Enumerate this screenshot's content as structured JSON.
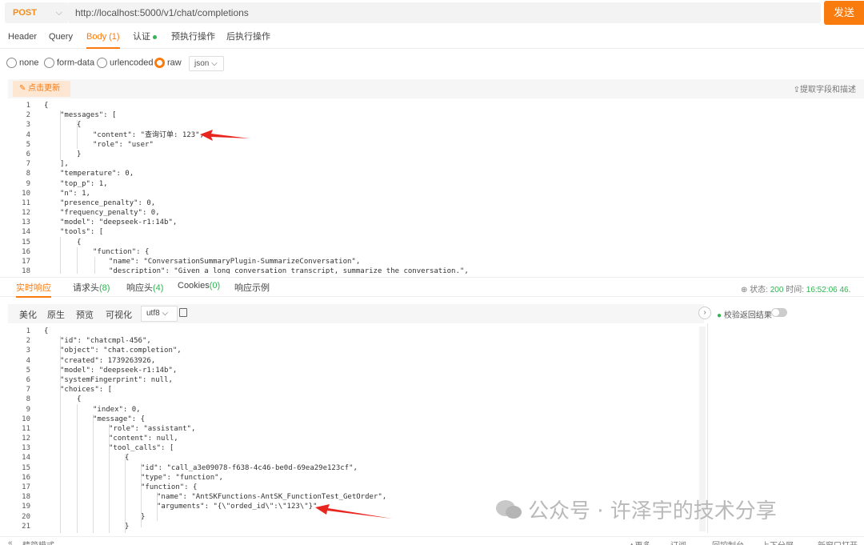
{
  "request": {
    "method": "POST",
    "url": "http://localhost:5000/v1/chat/completions",
    "send_label": "发送"
  },
  "req_tabs": [
    {
      "label": "Header"
    },
    {
      "label": "Query"
    },
    {
      "label": "Body (1)"
    },
    {
      "label": "认证"
    },
    {
      "label": "预执行操作"
    },
    {
      "label": "后执行操作"
    }
  ],
  "body_types": [
    {
      "label": "none"
    },
    {
      "label": "form-data"
    },
    {
      "label": "urlencoded"
    },
    {
      "label": "raw"
    }
  ],
  "format_select": "json",
  "editor": {
    "update_label": "点击更新",
    "extract_label": "提取字段和描述"
  },
  "request_lines": [
    {
      "n": "1",
      "t": "{"
    },
    {
      "n": "2",
      "t": "\"messages\": ["
    },
    {
      "n": "3",
      "t": "{"
    },
    {
      "n": "4",
      "t": "\"content\": \"查询订单: 123\","
    },
    {
      "n": "5",
      "t": "\"role\": \"user\""
    },
    {
      "n": "6",
      "t": "}"
    },
    {
      "n": "7",
      "t": "],"
    },
    {
      "n": "8",
      "t": "\"temperature\": 0,"
    },
    {
      "n": "9",
      "t": "\"top_p\": 1,"
    },
    {
      "n": "10",
      "t": "\"n\": 1,"
    },
    {
      "n": "11",
      "t": "\"presence_penalty\": 0,"
    },
    {
      "n": "12",
      "t": "\"frequency_penalty\": 0,"
    },
    {
      "n": "13",
      "t": "\"model\": \"deepseek-r1:14b\","
    },
    {
      "n": "14",
      "t": "\"tools\": ["
    },
    {
      "n": "15",
      "t": "{"
    },
    {
      "n": "16",
      "t": "\"function\": {"
    },
    {
      "n": "17",
      "t": "\"name\": \"ConversationSummaryPlugin-SummarizeConversation\","
    },
    {
      "n": "18",
      "t": "\"description\": \"Given a long conversation transcript, summarize the conversation.\","
    }
  ],
  "resp_tabs": [
    {
      "label": "实时响应"
    },
    {
      "label": "请求头",
      "count": "(8)"
    },
    {
      "label": "响应头",
      "count": "(4)"
    },
    {
      "label": "Cookies",
      "count": "(0)"
    },
    {
      "label": "响应示例"
    }
  ],
  "status_bar": {
    "status_label": "状态:",
    "status_code": "200",
    "time_label": "时间:",
    "time_value": "16:52:06",
    "extra": "46."
  },
  "resp_toolbar": [
    "美化",
    "原生",
    "预览",
    "可视化"
  ],
  "encoding": "utf8",
  "verify_label": "校验返回结果",
  "response_lines": [
    {
      "n": "1",
      "t": "{"
    },
    {
      "n": "2",
      "t": "\"id\": \"chatcmpl-456\","
    },
    {
      "n": "3",
      "t": "\"object\": \"chat.completion\","
    },
    {
      "n": "4",
      "t": "\"created\": 1739263926,"
    },
    {
      "n": "5",
      "t": "\"model\": \"deepseek-r1:14b\","
    },
    {
      "n": "6",
      "t": "\"systemFingerprint\": null,"
    },
    {
      "n": "7",
      "t": "\"choices\": ["
    },
    {
      "n": "8",
      "t": "{"
    },
    {
      "n": "9",
      "t": "\"index\": 0,"
    },
    {
      "n": "10",
      "t": "\"message\": {"
    },
    {
      "n": "11",
      "t": "\"role\": \"assistant\","
    },
    {
      "n": "12",
      "t": "\"content\": null,"
    },
    {
      "n": "13",
      "t": "\"tool_calls\": ["
    },
    {
      "n": "14",
      "t": "{"
    },
    {
      "n": "15",
      "t": "\"id\": \"call_a3e09078-f638-4c46-be0d-69ea29e123cf\","
    },
    {
      "n": "16",
      "t": "\"type\": \"function\","
    },
    {
      "n": "17",
      "t": "\"function\": {"
    },
    {
      "n": "18",
      "t": "\"name\": \"AntSKFunctions-AntSK_FunctionTest_GetOrder\","
    },
    {
      "n": "19",
      "t": "\"arguments\": \"{\\\"orded_id\\\":\\\"123\\\"}\""
    },
    {
      "n": "20",
      "t": "}"
    },
    {
      "n": "21",
      "t": "}"
    }
  ],
  "bottom_bar": [
    "«",
    "精简模式",
    "∧更多",
    "订阅",
    "回控制台",
    "上下分屏",
    "新窗口打开"
  ],
  "watermark": "公众号 · 许泽宇的技术分享",
  "colors": {
    "accent": "#f97a0d",
    "success": "#2fb551",
    "key": "#a3162f",
    "string": "#2450b4"
  }
}
